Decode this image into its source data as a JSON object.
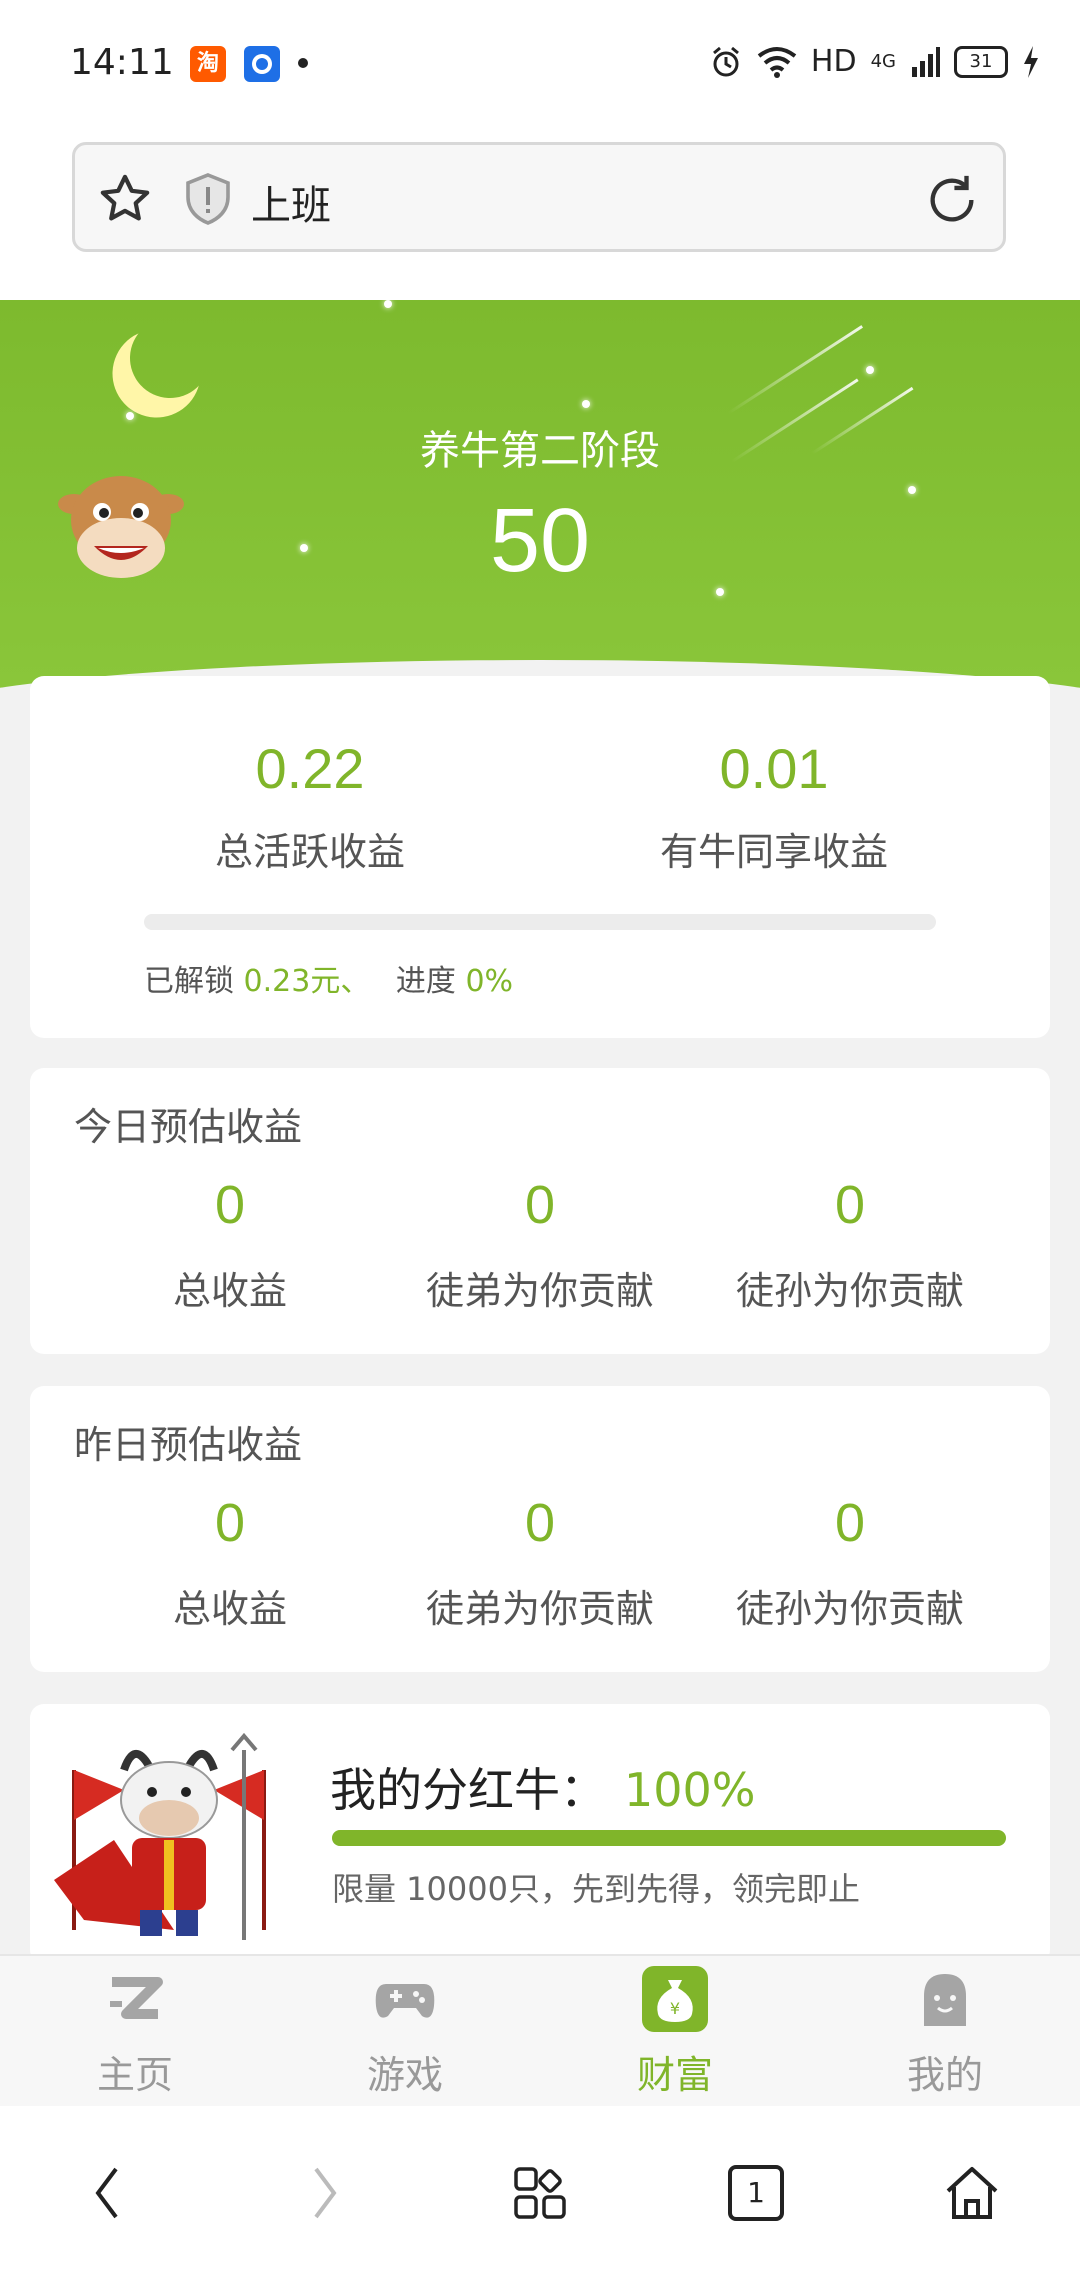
{
  "status_bar": {
    "time": "14:11",
    "taobao_glyph": "淘",
    "network": "HD",
    "signal": "4G",
    "battery": "31"
  },
  "url_bar": {
    "text": "上班",
    "icons": [
      "star-icon",
      "shield-icon",
      "reload-icon"
    ]
  },
  "hero": {
    "stage_title": "养牛第二阶段",
    "stage_value": "50"
  },
  "summary": {
    "total_active_value": "0.22",
    "total_active_label": "总活跃收益",
    "shared_value": "0.01",
    "shared_label": "有牛同享收益",
    "unlock_prefix": "已解锁",
    "unlock_amount": "0.23元、",
    "progress_prefix": "进度",
    "progress_text": "0%",
    "progress_fraction": 0
  },
  "today": {
    "title": "今日预估收益",
    "cells": [
      {
        "value": "0",
        "label": "总收益"
      },
      {
        "value": "0",
        "label": "徒弟为你贡献"
      },
      {
        "value": "0",
        "label": "徒孙为你贡献"
      }
    ]
  },
  "yesterday": {
    "title": "昨日预估收益",
    "cells": [
      {
        "value": "0",
        "label": "总收益"
      },
      {
        "value": "0",
        "label": "徒弟为你贡献"
      },
      {
        "value": "0",
        "label": "徒孙为你贡献"
      }
    ]
  },
  "dividend": {
    "title": "我的分红牛：",
    "percent": "100%",
    "fraction": 1,
    "note": "限量 10000只，先到先得，领完即止"
  },
  "tabs": [
    {
      "label": "主页",
      "icon": "home-z-icon"
    },
    {
      "label": "游戏",
      "icon": "gamepad-icon"
    },
    {
      "label": "财富",
      "icon": "money-bag-icon"
    },
    {
      "label": "我的",
      "icon": "profile-icon"
    }
  ],
  "browser_nav": {
    "tab_count": "1",
    "icons": [
      "back-icon",
      "forward-icon",
      "apps-icon",
      "tabs-icon",
      "home-icon"
    ]
  },
  "colors": {
    "accent": "#80b52a",
    "hero": "#85c134"
  }
}
